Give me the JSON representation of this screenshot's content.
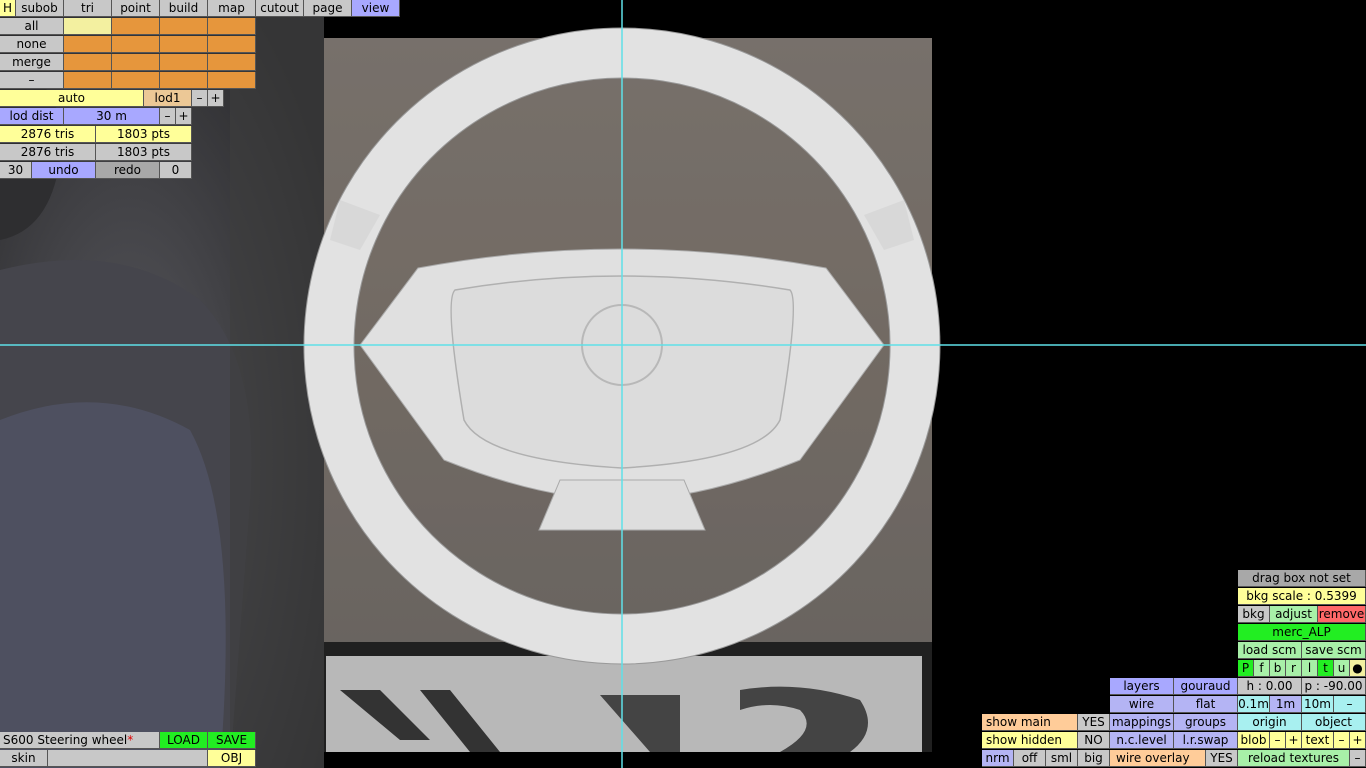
{
  "menu": {
    "h": "H",
    "tabs": [
      "subob",
      "tri",
      "point",
      "build",
      "map",
      "cutout",
      "page",
      "view"
    ]
  },
  "select": {
    "all": "all",
    "none": "none",
    "merge": "merge",
    "dash": "–"
  },
  "lod": {
    "auto": "auto",
    "lod1": "lod1",
    "minus": "–",
    "plus": "+",
    "lod_dist_label": "lod dist",
    "lod_dist_value": "30 m",
    "tris1": "2876 tris",
    "pts1": "1803 pts",
    "tris2": "2876 tris",
    "pts2": "1803 pts",
    "undo_count": "30",
    "undo": "undo",
    "redo": "redo",
    "redo_count": "0"
  },
  "file": {
    "name": "S600 Steering wheel",
    "modified_mark": "*",
    "load": "LOAD",
    "save": "SAVE",
    "skin": "skin",
    "obj": "OBJ"
  },
  "bkg": {
    "drag_box": "drag box not set",
    "scale": "bkg scale : 0.5399",
    "bkg": "bkg",
    "adjust": "adjust",
    "remove": "remove",
    "texture": "merc_ALP",
    "load_scm": "load scm",
    "save_scm": "save scm",
    "flags": [
      "P",
      "f",
      "b",
      "r",
      "l",
      "t",
      "u",
      "●"
    ]
  },
  "view": {
    "layers": "layers",
    "gouraud": "gouraud",
    "h": "h : 0.00",
    "p": "p : -90.00",
    "wire": "wire",
    "flat": "flat",
    "grid": [
      "0.1m",
      "1m",
      "10m",
      "–"
    ],
    "show_main": "show main",
    "show_main_val": "YES",
    "mappings": "mappings",
    "groups": "groups",
    "origin": "origin",
    "object": "object",
    "show_hidden": "show hidden",
    "show_hidden_val": "NO",
    "nc_level": "n.c.level",
    "lr_swap": "l.r.swap",
    "blob": "blob",
    "text": "text",
    "minus": "–",
    "plus": "+",
    "nrm": "nrm",
    "off": "off",
    "sml": "sml",
    "big": "big",
    "wire_overlay": "wire overlay",
    "wire_overlay_val": "YES",
    "reload": "reload textures"
  },
  "colors": {
    "crosshair": "#5fe0e8",
    "wheel": "#e4e4e4"
  }
}
